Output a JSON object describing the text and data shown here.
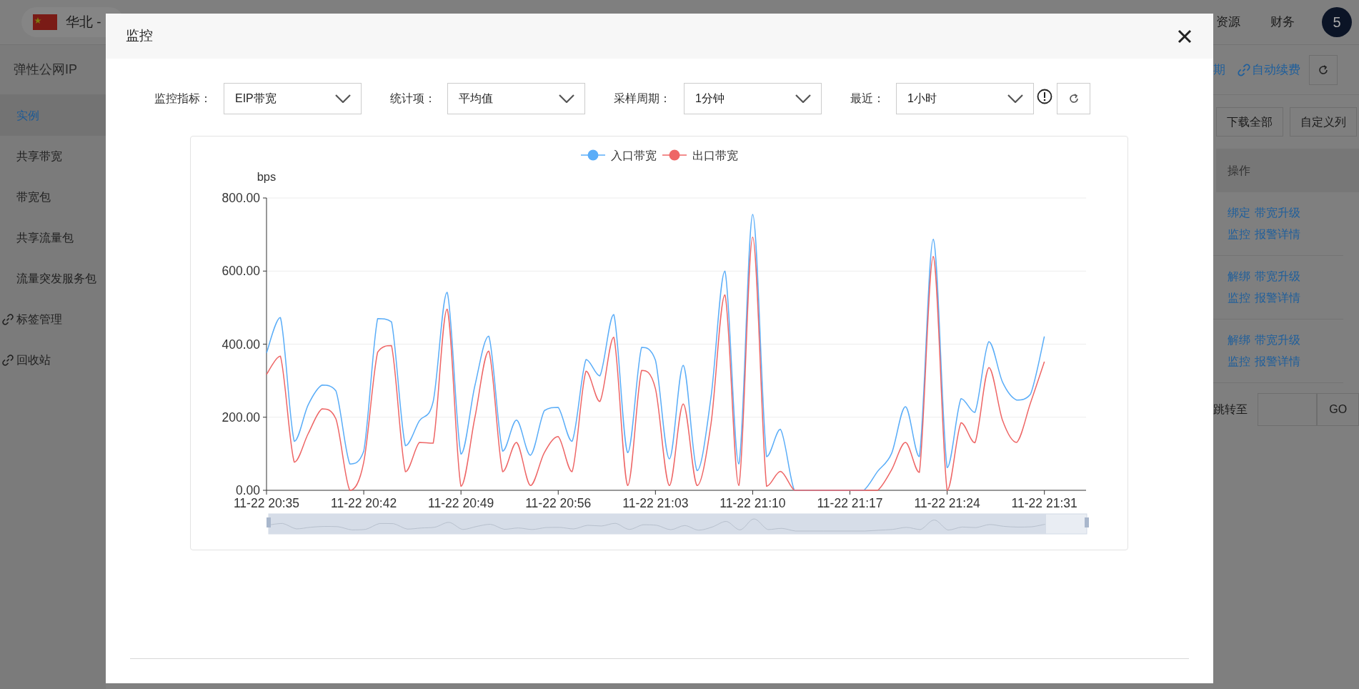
{
  "top_bar": {
    "region": "华北 -",
    "menu": [
      "资源",
      "财务"
    ],
    "avatar": "5"
  },
  "sidebar": {
    "title": "弹性公网IP",
    "items": [
      {
        "label": "实例",
        "selected": true,
        "icon": false
      },
      {
        "label": "共享带宽",
        "selected": false,
        "icon": false
      },
      {
        "label": "带宽包",
        "selected": false,
        "icon": false
      },
      {
        "label": "共享流量包",
        "selected": false,
        "icon": false
      },
      {
        "label": "流量突发服务包",
        "selected": false,
        "icon": false
      },
      {
        "label": "标签管理",
        "selected": false,
        "icon": true
      },
      {
        "label": "回收站",
        "selected": false,
        "icon": true
      }
    ]
  },
  "page": {
    "toolbar_links": [
      {
        "label": "期",
        "icon": false
      },
      {
        "label": "自动续费",
        "icon": true
      }
    ],
    "buttons": [
      "下载全部",
      "自定义列"
    ],
    "table": {
      "columns": [
        "操作"
      ],
      "rows": [
        {
          "links": [
            "绑定",
            "带宽升级",
            "监控",
            "报警详情"
          ]
        },
        {
          "links": [
            "解绑",
            "带宽升级",
            "监控",
            "报警详情"
          ]
        },
        {
          "links": [
            "解绑",
            "带宽升级",
            "监控",
            "报警详情"
          ]
        }
      ]
    },
    "pagination": {
      "jump_label": "跳转至",
      "go": "GO"
    }
  },
  "modal": {
    "title": "监控",
    "filters": [
      {
        "label": "监控指标：",
        "value": "EIP带宽"
      },
      {
        "label": "统计项：",
        "value": "平均值"
      },
      {
        "label": "采样周期：",
        "value": "1分钟"
      },
      {
        "label": "最近：",
        "value": "1小时"
      }
    ],
    "chart_data": {
      "type": "line",
      "ylabel": "bps",
      "ylim": [
        0,
        800
      ],
      "grid": true,
      "legend": true,
      "yticks": [
        {
          "value": 0,
          "label": "0.00"
        },
        {
          "value": 200,
          "label": "200.00"
        },
        {
          "value": 400,
          "label": "400.00"
        },
        {
          "value": 600,
          "label": "600.00"
        },
        {
          "value": 800,
          "label": "800.00"
        }
      ],
      "categories": [
        "11-22 20:35",
        null,
        null,
        null,
        null,
        null,
        null,
        "11-22 20:42",
        null,
        null,
        null,
        null,
        null,
        null,
        "11-22 20:49",
        null,
        null,
        null,
        null,
        null,
        null,
        "11-22 20:56",
        null,
        null,
        null,
        null,
        null,
        null,
        "11-22 21:03",
        null,
        null,
        null,
        null,
        null,
        null,
        "11-22 21:10",
        null,
        null,
        null,
        null,
        null,
        null,
        "11-22 21:17",
        null,
        null,
        null,
        null,
        null,
        null,
        "11-22 21:24",
        null,
        null,
        null,
        null,
        null,
        null,
        "11-22 21:31",
        null,
        null,
        null
      ],
      "series": [
        {
          "name": "入口带宽",
          "color": "#5aadf8",
          "values": [
            376,
            473,
            134,
            234,
            288,
            272,
            72,
            107,
            470,
            461,
            122,
            190,
            243,
            542,
            99,
            286,
            422,
            107,
            192,
            96,
            218,
            227,
            134,
            358,
            313,
            481,
            103,
            391,
            356,
            86,
            342,
            54,
            255,
            600,
            72,
            755,
            92,
            167,
            0,
            0,
            0,
            0,
            0,
            0,
            52,
            101,
            229,
            92,
            687,
            62,
            251,
            213,
            407,
            295,
            247,
            263,
            421,
            null,
            null,
            null
          ]
        },
        {
          "name": "出口带宽",
          "color": "#ee6666",
          "values": [
            317,
            367,
            77,
            155,
            223,
            195,
            0,
            77,
            378,
            396,
            51,
            131,
            129,
            496,
            11,
            199,
            381,
            51,
            131,
            13,
            103,
            147,
            51,
            326,
            243,
            419,
            13,
            328,
            278,
            13,
            236,
            13,
            182,
            535,
            13,
            693,
            11,
            52,
            0,
            0,
            0,
            0,
            0,
            0,
            0,
            56,
            131,
            49,
            640,
            0,
            185,
            130,
            336,
            190,
            131,
            239,
            352,
            null,
            null,
            null
          ]
        }
      ]
    }
  }
}
